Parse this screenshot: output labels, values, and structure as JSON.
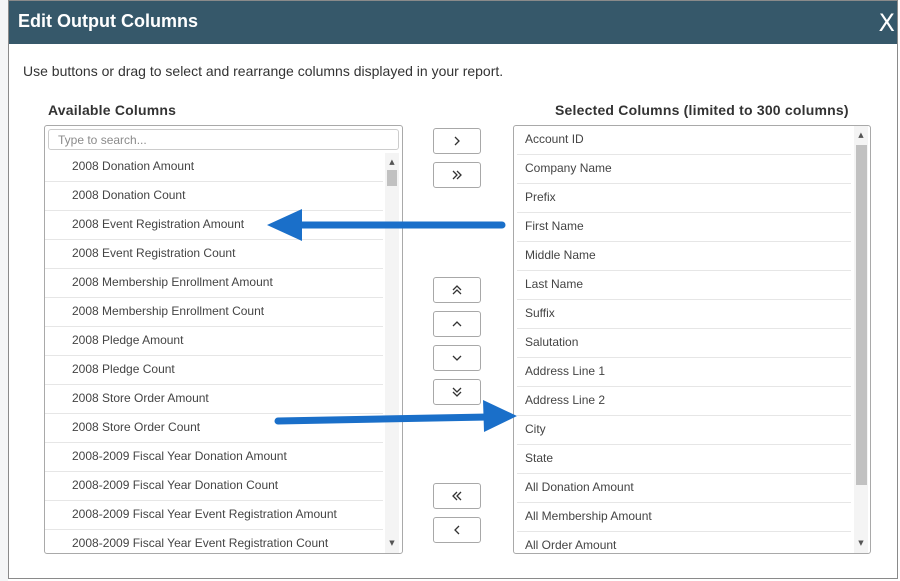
{
  "dialog": {
    "title": "Edit Output Columns",
    "close_label": "X",
    "instructions": "Use buttons or drag to select and rearrange columns displayed in your report."
  },
  "available": {
    "heading": "Available Columns",
    "search_placeholder": "Type to search...",
    "items": [
      "2008 Donation Amount",
      "2008 Donation Count",
      "2008 Event Registration Amount",
      "2008 Event Registration Count",
      "2008 Membership Enrollment Amount",
      "2008 Membership Enrollment Count",
      "2008 Pledge Amount",
      "2008 Pledge Count",
      "2008 Store Order Amount",
      "2008 Store Order Count",
      "2008-2009 Fiscal Year Donation Amount",
      "2008-2009 Fiscal Year Donation Count",
      "2008-2009 Fiscal Year Event Registration Amount",
      "2008-2009 Fiscal Year Event Registration Count"
    ]
  },
  "selected": {
    "heading": "Selected Columns (limited to 300 columns)",
    "items": [
      "Account ID",
      "Company Name",
      "Prefix",
      "First Name",
      "Middle Name",
      "Last Name",
      "Suffix",
      "Salutation",
      "Address Line 1",
      "Address Line 2",
      "City",
      "State",
      "All Donation Amount",
      "All Membership Amount",
      "All Order Amount"
    ]
  },
  "buttons": {
    "add_one": "chevron-right-icon",
    "add_all": "double-chevron-right-icon",
    "move_top": "double-chevron-up-icon",
    "move_up": "chevron-up-icon",
    "move_down": "chevron-down-icon",
    "move_bottom": "double-chevron-down-icon",
    "remove_all": "double-chevron-left-icon",
    "remove_one": "chevron-left-icon"
  },
  "colors": {
    "titlebar": "#36586a",
    "annotation_arrow": "#1a6fc9"
  }
}
